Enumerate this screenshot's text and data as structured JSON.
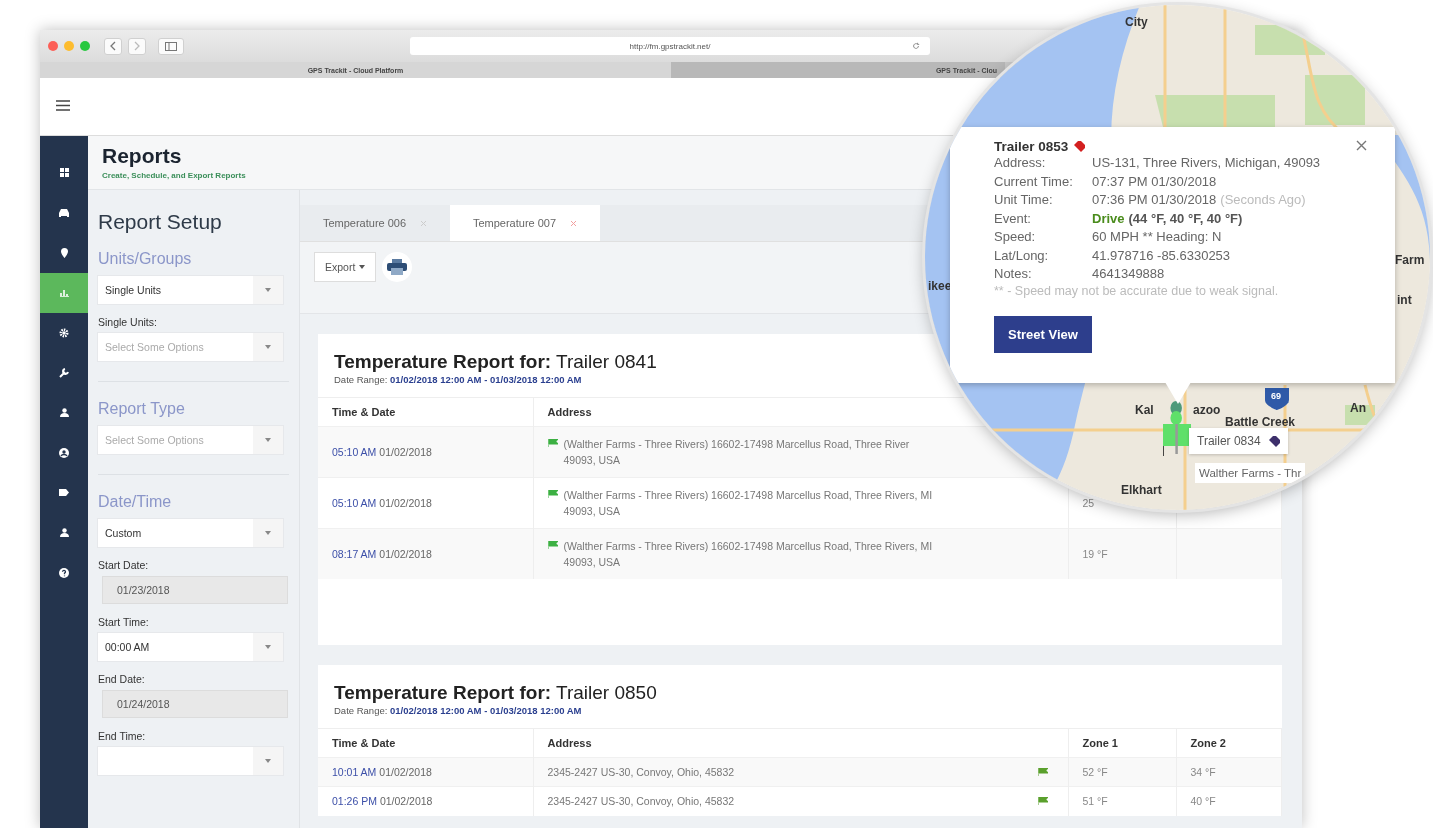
{
  "browser": {
    "url": "http://fm.gpstrackit.net/",
    "tabs": [
      {
        "label": "GPS Trackit - Cloud Platform",
        "selected": true
      },
      {
        "label": "GPS Trackit - Clou",
        "selected": false
      }
    ]
  },
  "nav": [
    {
      "selected": false
    },
    {
      "selected": false
    },
    {
      "selected": false
    },
    {
      "selected": true
    },
    {
      "selected": false
    },
    {
      "selected": false
    },
    {
      "selected": false
    },
    {
      "selected": false
    },
    {
      "selected": false
    },
    {
      "selected": false
    },
    {
      "selected": false
    }
  ],
  "header": {
    "title": "Reports",
    "subtitle": "Create, Schedule, and Export Reports"
  },
  "setup": {
    "title": "Report Setup",
    "items": [
      {
        "kind": "heading",
        "text": "Units/Groups"
      },
      {
        "kind": "select",
        "value": "Single Units"
      },
      {
        "kind": "label",
        "text": "Single Units:"
      },
      {
        "kind": "select",
        "placeholder": "Select Some Options"
      },
      {
        "kind": "heading",
        "text": "Report Type"
      },
      {
        "kind": "select",
        "placeholder": "Select Some Options"
      },
      {
        "kind": "heading",
        "text": "Date/Time"
      },
      {
        "kind": "select",
        "value": "Custom"
      },
      {
        "kind": "label",
        "text": "Start Date:"
      },
      {
        "kind": "date",
        "value": "01/23/2018"
      },
      {
        "kind": "label",
        "text": "Start Time:"
      },
      {
        "kind": "select",
        "value": "00:00 AM"
      },
      {
        "kind": "label",
        "text": "End Date:"
      },
      {
        "kind": "date",
        "value": "01/24/2018"
      },
      {
        "kind": "label",
        "text": "End Time:"
      },
      {
        "kind": "select"
      }
    ]
  },
  "report_tabs": [
    {
      "label": "Temperature 006",
      "selected": false
    },
    {
      "label": "Temperature 007",
      "selected": true
    }
  ],
  "toolbar": {
    "export": "Export"
  },
  "reports": [
    {
      "kind": "lead_flag",
      "title": "**Temperature Report for:** Trailer 0841",
      "date_range": "Date Range: **01/02/2018 12:00 AM - 01/03/2018 12:00 AM**",
      "columns": [
        "Time & Date",
        "Address"
      ],
      "rows": [
        {
          "time": "05:10 AM",
          "date": "01/02/2018",
          "flag": true,
          "address_lines": [
            "(Walther Farms - Three Rivers)  16602-17498 Marcellus Road, Three River",
            "49093, USA"
          ]
        },
        {
          "time": "05:10 AM",
          "date": "01/02/2018",
          "flag": true,
          "address_lines": [
            "(Walther Farms - Three Rivers)  16602-17498 Marcellus Road, Three Rivers, MI",
            "49093, USA"
          ],
          "readings": [
            "25"
          ]
        },
        {
          "time": "08:17 AM",
          "date": "01/02/2018",
          "flag": true,
          "address_lines": [
            "(Walther Farms - Three Rivers)  16602-17498 Marcellus Road, Three Rivers, MI",
            "49093, USA"
          ],
          "readings": [
            "19 °F"
          ]
        }
      ]
    },
    {
      "kind": "trail_flag",
      "title": "**Temperature Report for:** Trailer 0850",
      "date_range": "Date Range: **01/02/2018 12:00 AM - 01/03/2018 12:00 AM**",
      "columns": [
        "Time & Date",
        "Address",
        "Zone 1",
        "Zone 2"
      ],
      "rows": [
        {
          "time": "10:01 AM",
          "date": "01/02/2018",
          "flag": true,
          "address_lines": [
            "2345-2427 US-30, Convoy, Ohio, 45832"
          ],
          "readings": [
            "52 °F",
            "34 °F"
          ]
        },
        {
          "time": "01:26 PM",
          "date": "01/02/2018",
          "flag": true,
          "address_lines": [
            "2345-2427 US-30, Convoy, Ohio, 45832"
          ],
          "readings": [
            "51 °F",
            "40 °F"
          ]
        }
      ]
    }
  ],
  "map": {
    "labels": [
      "City",
      "ikee",
      "Farm",
      "int",
      "Kal",
      "azoo",
      "Battle Creek",
      "An",
      "Elkhart"
    ],
    "highway": "69",
    "marker_label": "Trailer 0834",
    "place_label": "Walther Farms - Thr",
    "popup": {
      "title": "Trailer 0853",
      "rows": [
        {
          "kind": "plain",
          "label": "Address:",
          "value": "US-131, Three Rivers, Michigan, 49093"
        },
        {
          "kind": "plain",
          "label": "Current Time:",
          "value": "07:37 PM 01/30/2018"
        },
        {
          "kind": "time",
          "label": "Unit Time:",
          "value": "07:36 PM 01/30/2018",
          "extra": "(Seconds Ago)"
        },
        {
          "kind": "event",
          "label": "Event:",
          "value": "Drive",
          "extra": "(44 °F, 40 °F, 40 °F)"
        },
        {
          "kind": "plain",
          "label": "Speed:",
          "value": "60 MPH ** Heading: N"
        },
        {
          "kind": "plain",
          "label": "Lat/Long:",
          "value": "41.978716 -85.6330253"
        },
        {
          "kind": "plain",
          "label": "Notes:",
          "value": "4641349888"
        }
      ],
      "note": "** - Speed may not be accurate due to weak signal.",
      "button": "Street View"
    }
  }
}
